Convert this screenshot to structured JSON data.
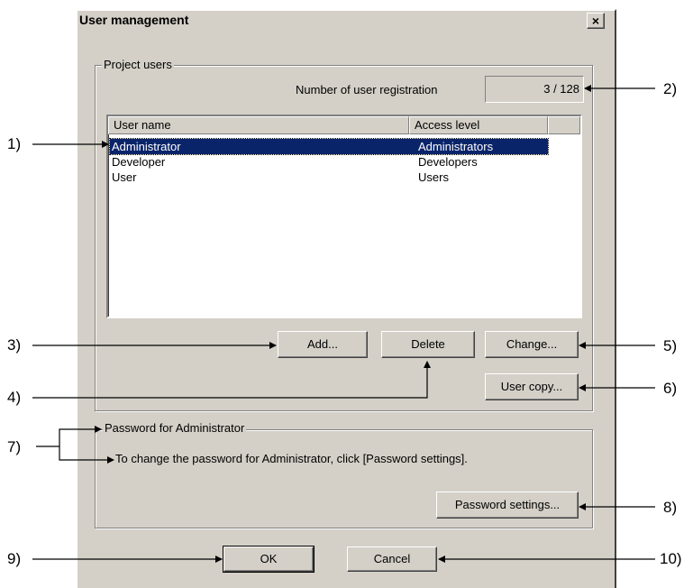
{
  "dialog": {
    "title": "User management",
    "close_label": "×"
  },
  "project_users": {
    "legend": "Project users",
    "registration_label": "Number of user registration",
    "registration_value": "3 / 128",
    "columns": [
      "User name",
      "Access level"
    ],
    "rows": [
      {
        "user": "Administrator",
        "level": "Administrators",
        "selected": true
      },
      {
        "user": "Developer",
        "level": "Developers",
        "selected": false
      },
      {
        "user": "User",
        "level": "Users",
        "selected": false
      }
    ],
    "add_label": "Add...",
    "delete_label": "Delete",
    "change_label": "Change...",
    "user_copy_label": "User copy..."
  },
  "password": {
    "legend": "Password for Administrator",
    "description": "To change the password for Administrator, click [Password settings].",
    "settings_label": "Password settings..."
  },
  "footer": {
    "ok_label": "OK",
    "cancel_label": "Cancel"
  },
  "callouts": [
    "1)",
    "2)",
    "3)",
    "4)",
    "5)",
    "6)",
    "7)",
    "8)",
    "9)",
    "10)"
  ]
}
